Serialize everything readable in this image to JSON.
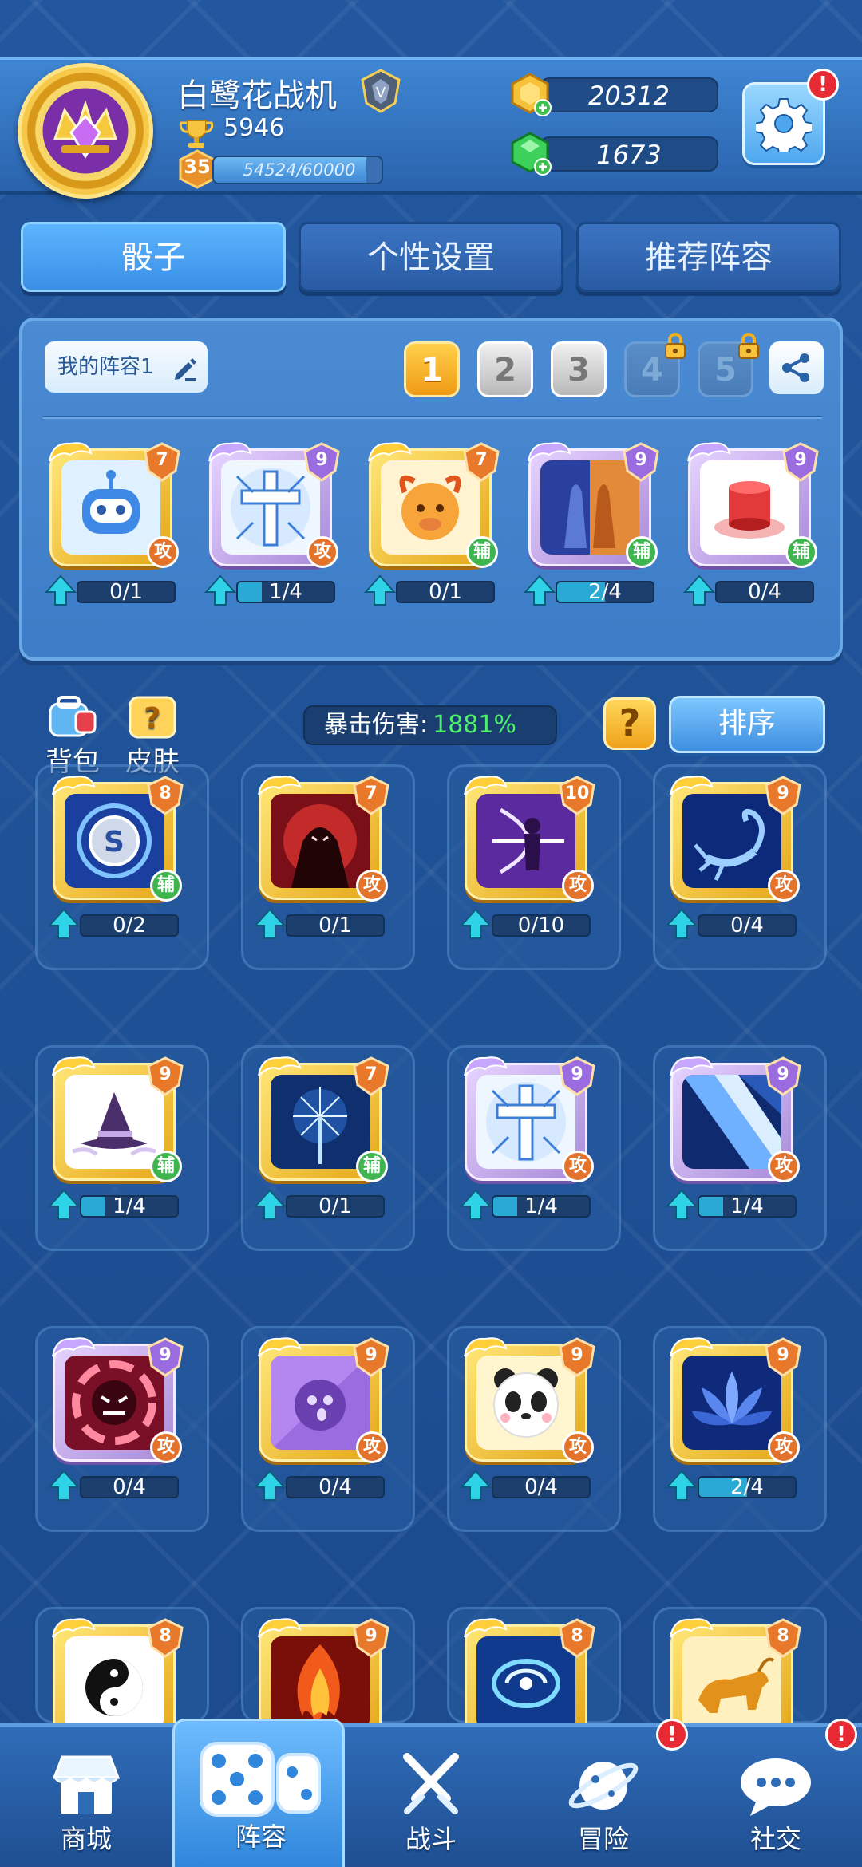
{
  "player": {
    "name": "白鹭花战机",
    "trophies": "5946",
    "level": "35",
    "xp_text": "54524/60000",
    "xp_fraction": 0.909
  },
  "currency": {
    "gold": "20312",
    "gems": "1673"
  },
  "settings_alert": "!",
  "tabs": [
    "骰子",
    "个性设置",
    "推荐阵容"
  ],
  "lineup": {
    "name": "我的阵容1",
    "slots": [
      "1",
      "2",
      "3",
      "4",
      "5"
    ],
    "dice": [
      {
        "level": "7",
        "type": "攻",
        "progress": "0/1",
        "fill": 0.0,
        "art": "robot-dice-icon",
        "frame": "gold"
      },
      {
        "level": "9",
        "type": "攻",
        "progress": "1/4",
        "fill": 0.25,
        "art": "holy-cross-dice-icon",
        "frame": "purple"
      },
      {
        "level": "7",
        "type": "辅",
        "progress": "0/1",
        "fill": 0.0,
        "art": "fire-bull-dice-icon",
        "frame": "gold"
      },
      {
        "level": "9",
        "type": "辅",
        "progress": "2/4",
        "fill": 0.5,
        "art": "mirror-figures-dice-icon",
        "frame": "purple"
      },
      {
        "level": "9",
        "type": "辅",
        "progress": "0/4",
        "fill": 0.0,
        "art": "red-pedestal-dice-icon",
        "frame": "purple"
      }
    ]
  },
  "side_buttons": {
    "backpack": "背包",
    "skins": "皮肤"
  },
  "crit": {
    "label": "暴击伤害:",
    "value": "1881%"
  },
  "help_label": "?",
  "sort_label": "排序",
  "collection": [
    {
      "level": "8",
      "type": "辅",
      "progress": "0/2",
      "fill": 0.0,
      "art": "s-coin-dice-icon",
      "frame": "gold"
    },
    {
      "level": "7",
      "type": "攻",
      "progress": "0/1",
      "fill": 0.0,
      "art": "vampire-dice-icon",
      "frame": "gold"
    },
    {
      "level": "10",
      "type": "攻",
      "progress": "0/10",
      "fill": 0.0,
      "art": "archer-dice-icon",
      "frame": "gold"
    },
    {
      "level": "9",
      "type": "攻",
      "progress": "0/4",
      "fill": 0.0,
      "art": "scorpion-dice-icon",
      "frame": "gold"
    },
    {
      "level": "9",
      "type": "辅",
      "progress": "1/4",
      "fill": 0.25,
      "art": "witch-hat-dice-icon",
      "frame": "gold"
    },
    {
      "level": "7",
      "type": "辅",
      "progress": "0/1",
      "fill": 0.0,
      "art": "dandelion-dice-icon",
      "frame": "gold"
    },
    {
      "level": "9",
      "type": "攻",
      "progress": "1/4",
      "fill": 0.25,
      "art": "holy-cross-dice-icon",
      "frame": "purple"
    },
    {
      "level": "9",
      "type": "攻",
      "progress": "1/4",
      "fill": 0.25,
      "art": "light-beam-dice-icon",
      "frame": "purple"
    },
    {
      "level": "9",
      "type": "攻",
      "progress": "0/4",
      "fill": 0.0,
      "art": "demon-vortex-dice-icon",
      "frame": "purple"
    },
    {
      "level": "9",
      "type": "攻",
      "progress": "0/4",
      "fill": 0.0,
      "art": "ghost-dice-icon",
      "frame": "gold"
    },
    {
      "level": "9",
      "type": "攻",
      "progress": "0/4",
      "fill": 0.0,
      "art": "panda-dice-icon",
      "frame": "gold"
    },
    {
      "level": "9",
      "type": "攻",
      "progress": "2/4",
      "fill": 0.5,
      "art": "lotus-dice-icon",
      "frame": "gold"
    },
    {
      "level": "8",
      "type": "",
      "progress": "",
      "fill": 0.0,
      "art": "yin-yang-dice-icon",
      "frame": "gold"
    },
    {
      "level": "9",
      "type": "",
      "progress": "",
      "fill": 0.0,
      "art": "flame-dice-icon",
      "frame": "gold"
    },
    {
      "level": "8",
      "type": "",
      "progress": "",
      "fill": 0.0,
      "art": "galaxy-dice-icon",
      "frame": "gold"
    },
    {
      "level": "8",
      "type": "",
      "progress": "",
      "fill": 0.0,
      "art": "golden-bull-dice-icon",
      "frame": "gold"
    }
  ],
  "nav": [
    {
      "label": "商城",
      "icon": "shop-icon",
      "alert": ""
    },
    {
      "label": "阵容",
      "icon": "dice-icon",
      "alert": ""
    },
    {
      "label": "战斗",
      "icon": "crossed-swords-icon",
      "alert": ""
    },
    {
      "label": "冒险",
      "icon": "planet-icon",
      "alert": "!"
    },
    {
      "label": "社交",
      "icon": "chat-icon",
      "alert": "!"
    }
  ]
}
